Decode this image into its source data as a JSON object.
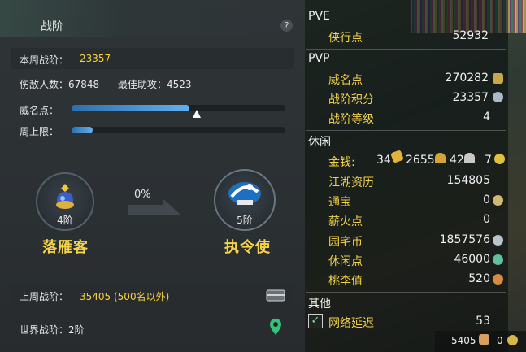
{
  "left": {
    "title": "战阶",
    "help": "?",
    "week_rank_label": "本周战阶：",
    "week_rank_value": "23357",
    "kills_label": "伤敌人数：67848",
    "assist_label": "最佳助攻：4523",
    "fame_label": "威名点：",
    "fame_progress": 0.55,
    "weekly_cap_label": "周上限：",
    "weekly_cap_progress": 0.1,
    "progress_pct": "0%",
    "current_rank_level": "4阶",
    "current_rank_name": "落雁客",
    "next_rank_level": "5阶",
    "next_rank_name": "执令使",
    "last_week_label": "上周战阶：",
    "last_week_value": "35405 (500名以外)",
    "world_rank_label": "世界战阶：2阶"
  },
  "right": {
    "pve_title": "PVE",
    "pve_items": [
      {
        "label": "侠行点",
        "value": "52932"
      }
    ],
    "pvp_title": "PVP",
    "pvp_items": [
      {
        "label": "威名点",
        "value": "270282"
      },
      {
        "label": "战阶积分",
        "value": "23357"
      },
      {
        "label": "战阶等级",
        "value": "4"
      }
    ],
    "leisure_title": "休闲",
    "money_label": "金钱:",
    "money_gold": "34",
    "money_silver": "2655",
    "money_copper": "42",
    "money_extra": "7",
    "leisure_items": [
      {
        "label": "江湖资历",
        "value": "154805"
      },
      {
        "label": "通宝",
        "value": "0"
      },
      {
        "label": "薪火点",
        "value": "0"
      },
      {
        "label": "园宅币",
        "value": "1857576"
      },
      {
        "label": "休闲点",
        "value": "46000"
      },
      {
        "label": "桃李值",
        "value": "520"
      }
    ],
    "other_title": "其他",
    "latency_label": "网络延迟",
    "latency_value": "53",
    "footer_left": "5405",
    "footer_right": "0"
  },
  "colors": {
    "accent_gold": "#f3d24a",
    "bar_blue": "#4a9be0"
  }
}
